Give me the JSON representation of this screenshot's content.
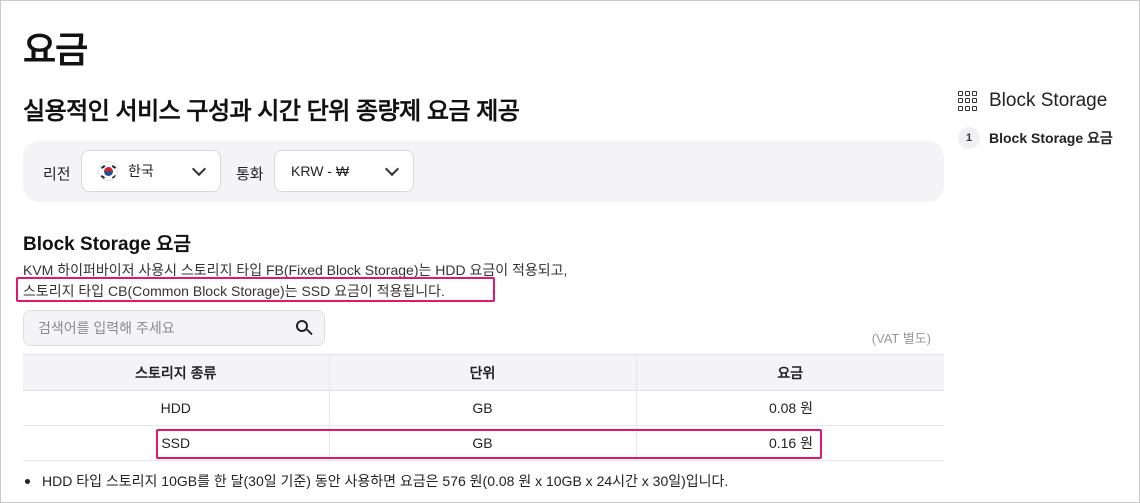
{
  "header": {
    "title": "요금",
    "subtitle": "실용적인 서비스 구성과 시간 단위 종량제 요금 제공"
  },
  "filters": {
    "region_label": "리전",
    "region_value": "한국",
    "currency_label": "통화",
    "currency_value": "KRW - ₩"
  },
  "section": {
    "title": "Block Storage 요금",
    "desc_line1": "KVM 하이퍼바이저 사용시 스토리지 타입 FB(Fixed Block Storage)는 HDD 요금이 적용되고,",
    "desc_line2": "스토리지 타입 CB(Common Block Storage)는 SSD 요금이 적용됩니다."
  },
  "search": {
    "placeholder": "검색어를 입력해 주세요"
  },
  "vat_note": "(VAT 별도)",
  "table": {
    "headers": [
      "스토리지 종류",
      "단위",
      "요금"
    ],
    "rows": [
      [
        "HDD",
        "GB",
        "0.08 원"
      ],
      [
        "SSD",
        "GB",
        "0.16 원"
      ]
    ]
  },
  "footnote": "HDD 타입 스토리지 10GB를 한 달(30일 기준) 동안 사용하면 요금은 576 원(0.08 원 x 10GB x 24시간 x 30일)입니다.",
  "toc": {
    "title": "Block Storage",
    "items": [
      {
        "num": "1",
        "label": "Block Storage 요금"
      }
    ]
  },
  "colors": {
    "highlight": "#e0176c"
  },
  "icons": {
    "flag": "korea-flag-icon",
    "dropdown": "chevron-down-icon",
    "search": "search-icon",
    "toc": "grid-icon"
  }
}
